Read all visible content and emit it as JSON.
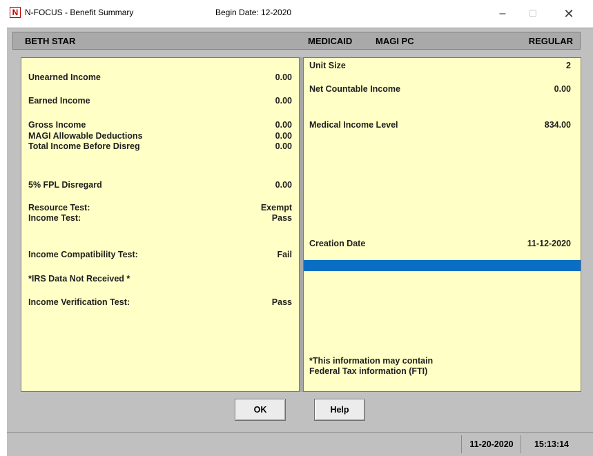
{
  "titlebar": {
    "logo_letter": "N",
    "title": "N-FOCUS - Benefit Summary",
    "begin_date": "Begin Date: 12-2020",
    "minimize_glyph": "–",
    "maximize_glyph": "☐",
    "close_glyph": "✕"
  },
  "header": {
    "name": "BETH STAR",
    "program": "MEDICAID",
    "subprogram": "MAGI PC",
    "type": "REGULAR"
  },
  "left_panel": [
    {
      "label": "Unearned Income",
      "value": "0.00"
    },
    {
      "label": "Earned Income",
      "value": "0.00"
    },
    {
      "label": "Gross Income",
      "value": "0.00"
    },
    {
      "label": "MAGI Allowable Deductions",
      "value": "0.00"
    },
    {
      "label": "Total Income Before Disreg",
      "value": "0.00"
    },
    {
      "label": "5% FPL Disregard",
      "value": "0.00"
    },
    {
      "label": "Resource Test:",
      "value": "Exempt"
    },
    {
      "label": "Income Test:",
      "value": "Pass"
    },
    {
      "label": "Income Compatibility Test:",
      "value": "Fail"
    },
    {
      "label": "*IRS Data Not Received  *",
      "value": ""
    },
    {
      "label": "Income Verification Test:",
      "value": "Pass"
    }
  ],
  "right_panel": {
    "rows": [
      {
        "label": "Unit Size",
        "value": "2"
      },
      {
        "label": "Net Countable Income",
        "value": "0.00"
      },
      {
        "label": "Medical Income Level",
        "value": "834.00"
      },
      {
        "label": "Creation Date",
        "value": "11-12-2020"
      }
    ],
    "fti_note": "*This information may contain Federal Tax information (FTI)"
  },
  "buttons": {
    "ok": "OK",
    "help": "Help"
  },
  "status": {
    "date": "11-20-2020",
    "time": "15:13:14"
  },
  "colors": {
    "panel_bg": "#ffffc6",
    "selection": "#0a6fc2",
    "window_bg": "#c0c0c0"
  }
}
